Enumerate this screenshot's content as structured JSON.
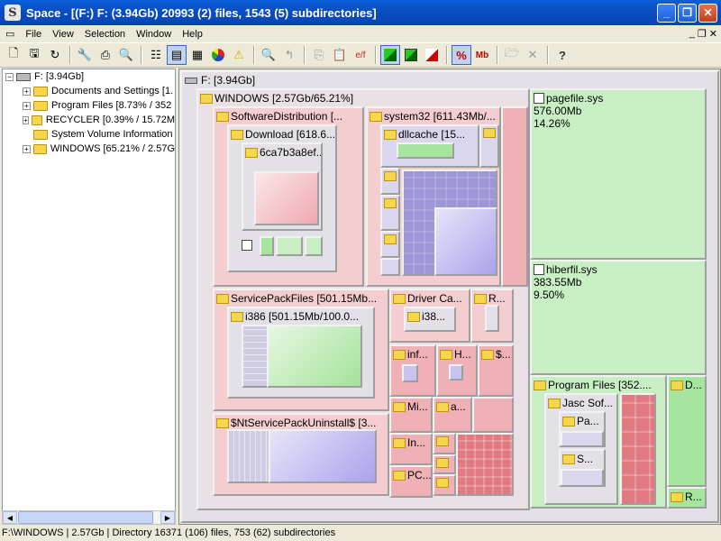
{
  "window": {
    "title": "Space - [(F:) F: (3.94Gb) 20993 (2) files, 1543 (5) subdirectories]",
    "app_letter": "S"
  },
  "menu": [
    "File",
    "View",
    "Selection",
    "Window",
    "Help"
  ],
  "toolbar_icons": [
    "new-icon",
    "open-icon",
    "refresh-icon",
    "tools-icon",
    "print-icon",
    "print-preview-icon",
    "tree-view-icon",
    "list-view-icon",
    "table-view-icon",
    "pie-chart-icon",
    "warning-icon",
    "search-icon",
    "up-icon",
    "copy-icon",
    "paste-icon",
    "extensions-icon",
    "green-map-icon",
    "green-map-2-icon",
    "red-map-icon",
    "percent-icon",
    "mb-icon",
    "folder-open-icon",
    "delete-icon",
    "help-icon"
  ],
  "toolbar_labels": {
    "percent": "%",
    "mb": "Mb",
    "help": "?"
  },
  "tree": {
    "root": "F:  [3.94Gb]",
    "items": [
      "Documents and Settings [1.",
      "Program Files [8.73% / 352",
      "RECYCLER [0.39% / 15.72M",
      "System Volume Information",
      "WINDOWS [65.21% / 2.57G"
    ]
  },
  "map": {
    "root_label": "F:  [3.94Gb]",
    "windows": "WINDOWS  [2.57Gb/65.21%]",
    "software_distribution": "SoftwareDistribution  [...",
    "download": "Download  [618.6...",
    "hash_folder": "6ca7b3a8ef...",
    "system32": "system32  [611.43Mb/...",
    "dllcache": "dllcache  [15...",
    "service_pack_files": "ServicePackFiles  [501.15Mb...",
    "i386": "i386  [501.15Mb/100.0...",
    "nt_uninstall": "$NtServicePackUninstall$  [3...",
    "driver_cache": "Driver Ca...",
    "i386_2": "i38...",
    "r_folder": "R...",
    "inf": "inf...",
    "h_folder": "H...",
    "dollar": "$...",
    "mi": "Mi...",
    "a_folder": "a...",
    "in_folder": "In...",
    "pc_folder": "PC...",
    "pagefile": {
      "name": "pagefile.sys",
      "size": "576.00Mb",
      "pct": "14.26%"
    },
    "hiberfil": {
      "name": "hiberfil.sys",
      "size": "383.55Mb",
      "pct": "9.50%"
    },
    "program_files": "Program Files  [352....",
    "jasc": "Jasc Sof...",
    "pa": "Pa...",
    "s_folder": "S...",
    "d_folder": "D...",
    "r2_folder": "R..."
  },
  "status": "F:\\WINDOWS | 2.57Gb | Directory  16371 (106) files, 753 (62) subdirectories"
}
